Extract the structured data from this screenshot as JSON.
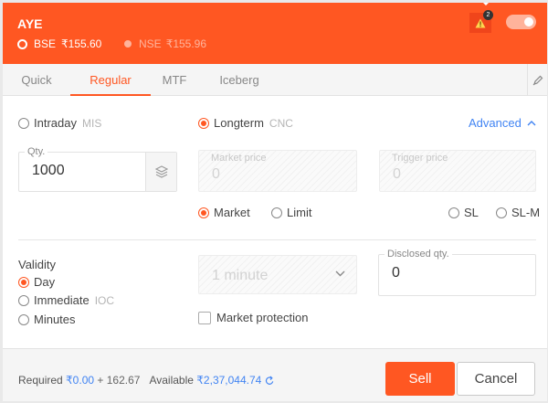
{
  "header": {
    "symbol": "AYE",
    "bse": {
      "label": "BSE",
      "price": "₹155.60"
    },
    "nse": {
      "label": "NSE",
      "price": "₹155.96"
    },
    "warning_count": "2",
    "toggle_on": true
  },
  "tabs": [
    {
      "label": "Quick",
      "active": false
    },
    {
      "label": "Regular",
      "active": true
    },
    {
      "label": "MTF",
      "active": false
    },
    {
      "label": "Iceberg",
      "active": false
    }
  ],
  "product": {
    "intraday": {
      "label": "Intraday",
      "code": "MIS",
      "selected": false
    },
    "longterm": {
      "label": "Longterm",
      "code": "CNC",
      "selected": true
    },
    "advanced_label": "Advanced"
  },
  "quantity": {
    "label": "Qty.",
    "value": "1000"
  },
  "market_price": {
    "label": "Market price",
    "value": "0"
  },
  "trigger_price": {
    "label": "Trigger price",
    "value": "0"
  },
  "order_type": {
    "market": {
      "label": "Market",
      "selected": true
    },
    "limit": {
      "label": "Limit",
      "selected": false
    },
    "sl": {
      "label": "SL",
      "selected": false
    },
    "slm": {
      "label": "SL-M",
      "selected": false
    }
  },
  "validity": {
    "label": "Validity",
    "day": {
      "label": "Day",
      "selected": true
    },
    "immediate": {
      "label": "Immediate",
      "code": "IOC",
      "selected": false
    },
    "minutes": {
      "label": "Minutes",
      "selected": false
    },
    "minutes_select": "1 minute"
  },
  "disclosed": {
    "label": "Disclosed qty.",
    "value": "0"
  },
  "market_protection": {
    "label": "Market protection",
    "checked": false
  },
  "footer": {
    "required_label": "Required",
    "required_value": "₹0.00",
    "plus": "+",
    "charges": "162.67",
    "available_label": "Available",
    "available_value": "₹2,37,044.74",
    "sell_label": "Sell",
    "cancel_label": "Cancel"
  },
  "colors": {
    "accent": "#ff5722",
    "link": "#4184f3"
  }
}
